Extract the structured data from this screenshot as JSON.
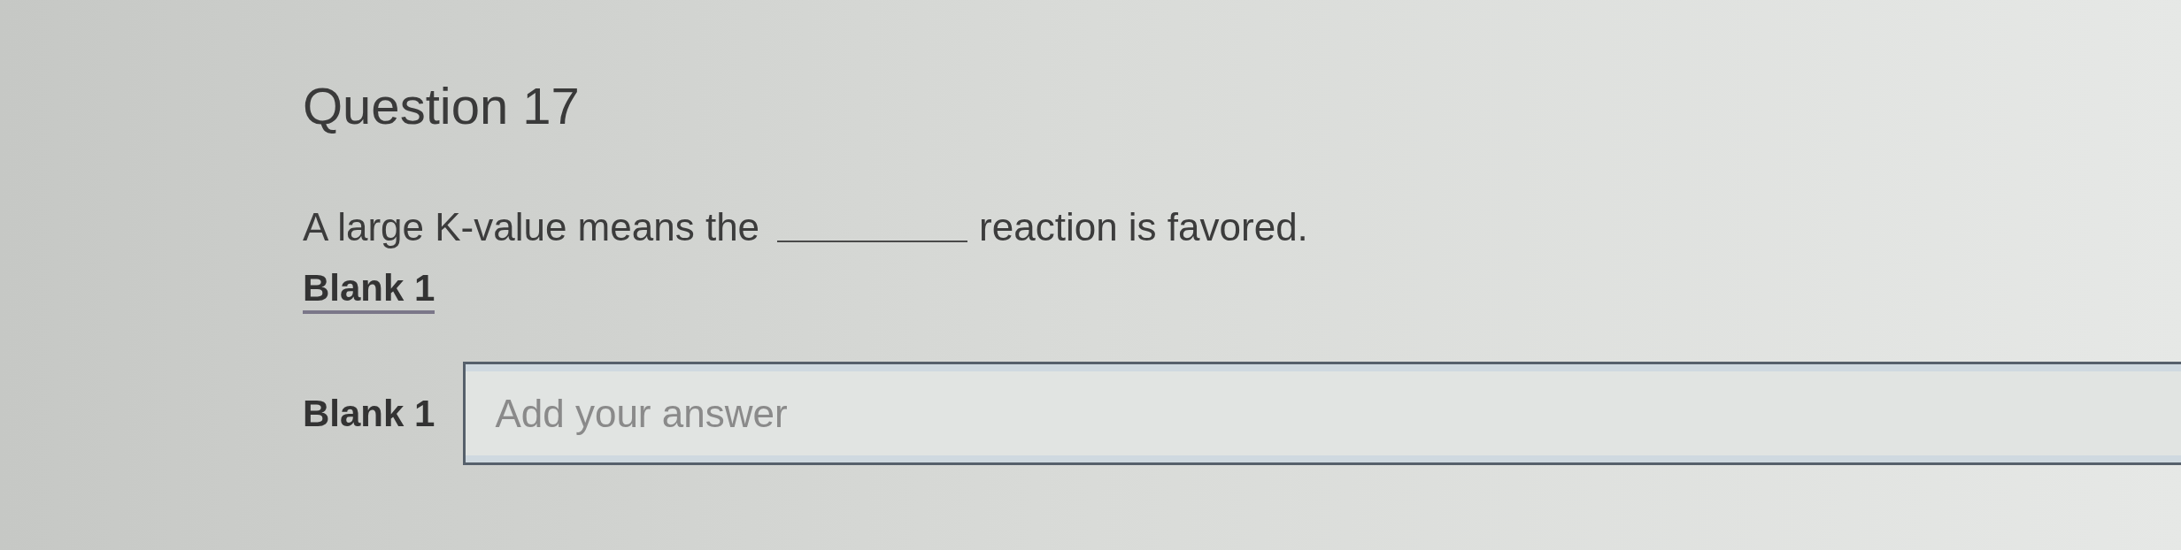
{
  "question": {
    "title": "Question 17",
    "prompt": {
      "before": "A large K-value means the",
      "after": "reaction is favored."
    },
    "blank_tabs": [
      {
        "label": "Blank 1",
        "selected": true
      }
    ],
    "answers": [
      {
        "label": "Blank 1",
        "placeholder": "Add your answer"
      }
    ]
  }
}
